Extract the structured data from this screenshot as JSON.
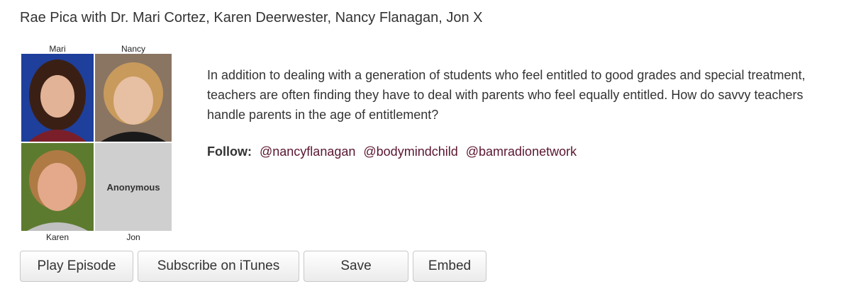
{
  "title": "Rae Pica with Dr. Mari Cortez, Karen Deerwester, Nancy Flanagan, Jon X",
  "collage": {
    "labels": {
      "mari": "Mari",
      "nancy": "Nancy",
      "karen": "Karen",
      "jon": "Jon"
    },
    "anonymous": "Anonymous"
  },
  "description": "In addition to dealing with a generation of students who feel entitled to good grades and special treatment, teachers are often finding they have to deal with parents who feel equally entitled. How do savvy teachers handle parents in the age of entitlement?",
  "follow": {
    "label": "Follow:",
    "handles": [
      "@nancyflanagan",
      "@bodymindchild",
      "@bamradionetwork"
    ]
  },
  "buttons": {
    "play": "Play Episode",
    "subscribe": "Subscribe on iTunes",
    "save": "Save",
    "embed": "Embed"
  },
  "colors": {
    "link": "#5a1630",
    "text": "#333333"
  }
}
